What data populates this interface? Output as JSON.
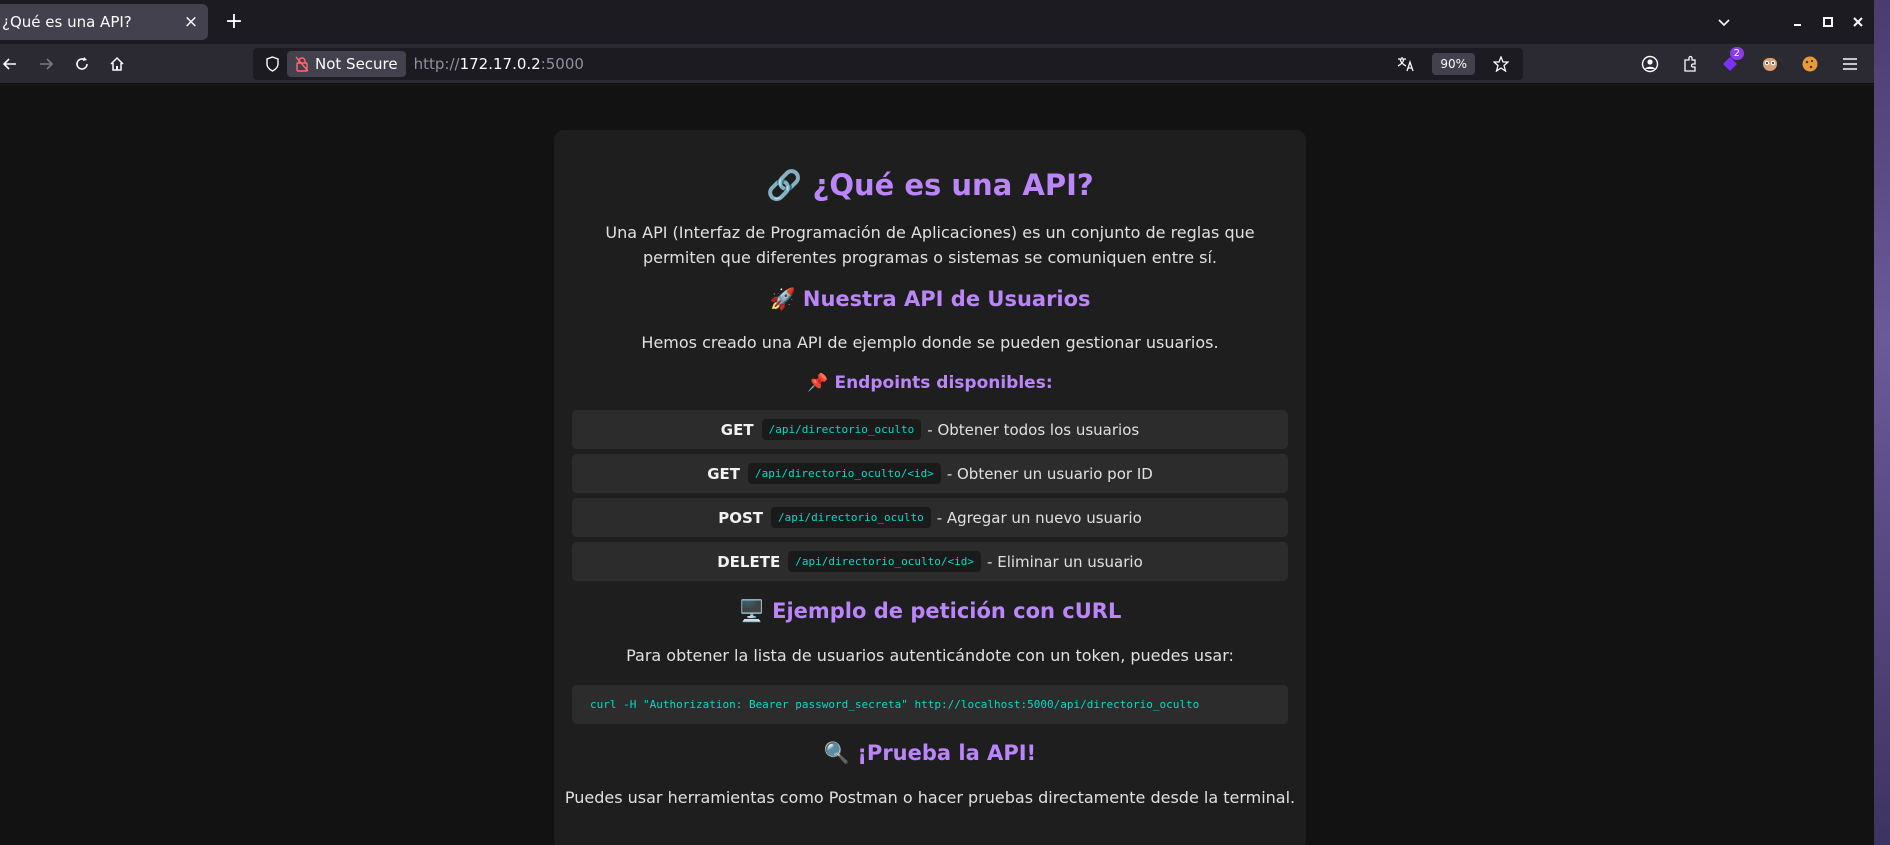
{
  "browser": {
    "tab_title": "¿Qué es una API?",
    "tab_close": "×",
    "new_tab": "+",
    "not_secure_label": "Not Secure",
    "url_scheme": "http://",
    "url_host": "172.17.0.2",
    "url_port": ":5000",
    "zoom": "90%",
    "extension_badge": "2"
  },
  "page": {
    "title": "🔗 ¿Qué es una API?",
    "intro": "Una API (Interfaz de Programación de Aplicaciones) es un conjunto de reglas que permiten que diferentes programas o sistemas se comuniquen entre sí.",
    "section1_title": "🚀 Nuestra API de Usuarios",
    "section1_text": "Hemos creado una API de ejemplo donde se pueden gestionar usuarios.",
    "endpoints_title": "📌 Endpoints disponibles:",
    "endpoints": [
      {
        "method": "GET",
        "path": "/api/directorio_oculto",
        "desc": "- Obtener todos los usuarios"
      },
      {
        "method": "GET",
        "path": "/api/directorio_oculto/<id>",
        "desc": "- Obtener un usuario por ID"
      },
      {
        "method": "POST",
        "path": "/api/directorio_oculto",
        "desc": "- Agregar un nuevo usuario"
      },
      {
        "method": "DELETE",
        "path": "/api/directorio_oculto/<id>",
        "desc": "- Eliminar un usuario"
      }
    ],
    "section2_title": "🖥️ Ejemplo de petición con cURL",
    "section2_text": "Para obtener la lista de usuarios autenticándote con un token, puedes usar:",
    "curl_command": "curl -H \"Authorization: Bearer password_secreta\" http://localhost:5000/api/directorio_oculto",
    "section3_title": "🔍 ¡Prueba la API!",
    "section3_text": "Puedes usar herramientas como Postman o hacer pruebas directamente desde la terminal."
  },
  "colors": {
    "accent": "#bb86fc",
    "code": "#03dac6",
    "card": "#1e1e1e",
    "background": "#121212"
  }
}
